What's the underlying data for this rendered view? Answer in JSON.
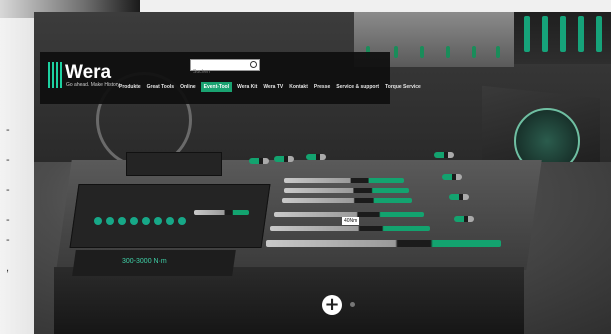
{
  "site": {
    "logo": "Wera",
    "tagline": "Go ahead. Make History.",
    "search_placeholder": "Suchen"
  },
  "nav": {
    "items": [
      {
        "label": "Produkte"
      },
      {
        "label": "Great Tools"
      },
      {
        "label": "Online"
      },
      {
        "label": "Event-Tool",
        "active": true
      },
      {
        "label": "Wera Kit"
      },
      {
        "label": "Wera TV"
      },
      {
        "label": "Kontakt"
      },
      {
        "label": "Presse"
      },
      {
        "label": "Service & support"
      },
      {
        "label": "Torque Service"
      }
    ]
  },
  "scene": {
    "wrench_label": "300-3000 N·m",
    "torque_tag": "40Nm",
    "plus_label": "+"
  },
  "icons": {
    "search": "search-icon",
    "plus": "plus-icon"
  },
  "colors": {
    "brand_green": "#1aa371",
    "header_bg": "#0e0e0e"
  }
}
